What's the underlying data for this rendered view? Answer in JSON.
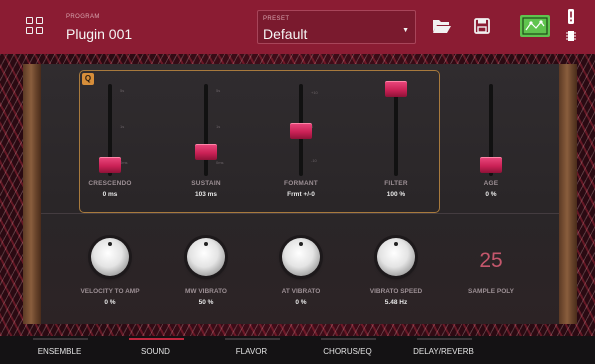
{
  "header": {
    "plugin_label": "PROGRAM",
    "plugin_name": "Plugin 001",
    "preset_label": "PRESET",
    "preset_value": "Default"
  },
  "icons": {
    "grid": "grid-menu-icon",
    "folder": "folder-open-icon",
    "save": "save-icon",
    "wave": "waveform-edit-icon",
    "warning": "warning-icon",
    "chip": "chip-icon"
  },
  "colors": {
    "header_bg": "#8b1c33",
    "accent": "#c0263e",
    "fader_thumb": "#d62d60",
    "active_button": "#5fc44e",
    "group_border": "#a87a3d"
  },
  "group_badge": "Q",
  "sliders": [
    {
      "label": "CRESCENDO",
      "value": "0 ms",
      "level": 0.1,
      "scale": [
        "5s",
        "1s",
        "0ms"
      ]
    },
    {
      "label": "SUSTAIN",
      "value": "103 ms",
      "level": 0.25,
      "scale": [
        "5s",
        "1s",
        "0ms"
      ]
    },
    {
      "label": "FORMANT",
      "value": "Frmt +/-0",
      "level": 0.5,
      "scale": [
        "+10",
        "0",
        "-10"
      ]
    },
    {
      "label": "FILTER",
      "value": "100 %",
      "level": 1.0,
      "scale": []
    },
    {
      "label": "AGE",
      "value": "0 %",
      "level": 0.1,
      "scale": []
    }
  ],
  "knobs": [
    {
      "label": "VELOCITY TO AMP",
      "value": "0 %"
    },
    {
      "label": "MW VIBRATO",
      "value": "50 %"
    },
    {
      "label": "AT VIBRATO",
      "value": "0 %"
    },
    {
      "label": "VIBRATO SPEED",
      "value": "5.48 Hz"
    }
  ],
  "sample_poly": {
    "value": "25",
    "label": "SAMPLE POLY"
  },
  "tabs": [
    {
      "label": "ENSEMBLE",
      "active": false
    },
    {
      "label": "SOUND",
      "active": true
    },
    {
      "label": "FLAVOR",
      "active": false
    },
    {
      "label": "CHORUS/EQ",
      "active": false
    },
    {
      "label": "DELAY/REVERB",
      "active": false
    }
  ]
}
